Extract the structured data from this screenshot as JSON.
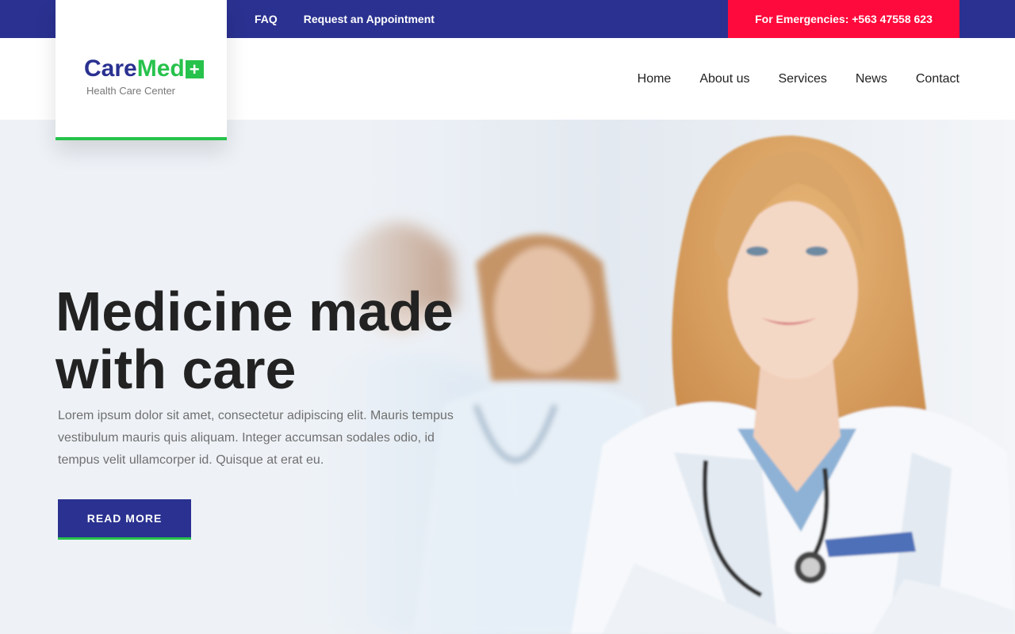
{
  "topbar": {
    "links": [
      "FAQ",
      "Request an Appointment"
    ],
    "emergency": "For Emergencies: +563 47558 623"
  },
  "logo": {
    "name_part1": "Care",
    "name_part2": "Med",
    "plus": "+",
    "tagline": "Health Care Center"
  },
  "nav": {
    "items": [
      "Home",
      "About us",
      "Services",
      "News",
      "Contact"
    ]
  },
  "hero": {
    "title": "Medicine made with care",
    "text": "Lorem ipsum dolor sit amet, consectetur adipiscing elit. Mauris tempus vestibulum mauris quis aliquam. Integer accumsan sodales odio, id tempus velit ullamcorper id. Quisque at erat eu.",
    "button": "READ MORE"
  },
  "colors": {
    "primary": "#2a3190",
    "accent": "#27c24c",
    "emergency": "#ff0a3c"
  }
}
